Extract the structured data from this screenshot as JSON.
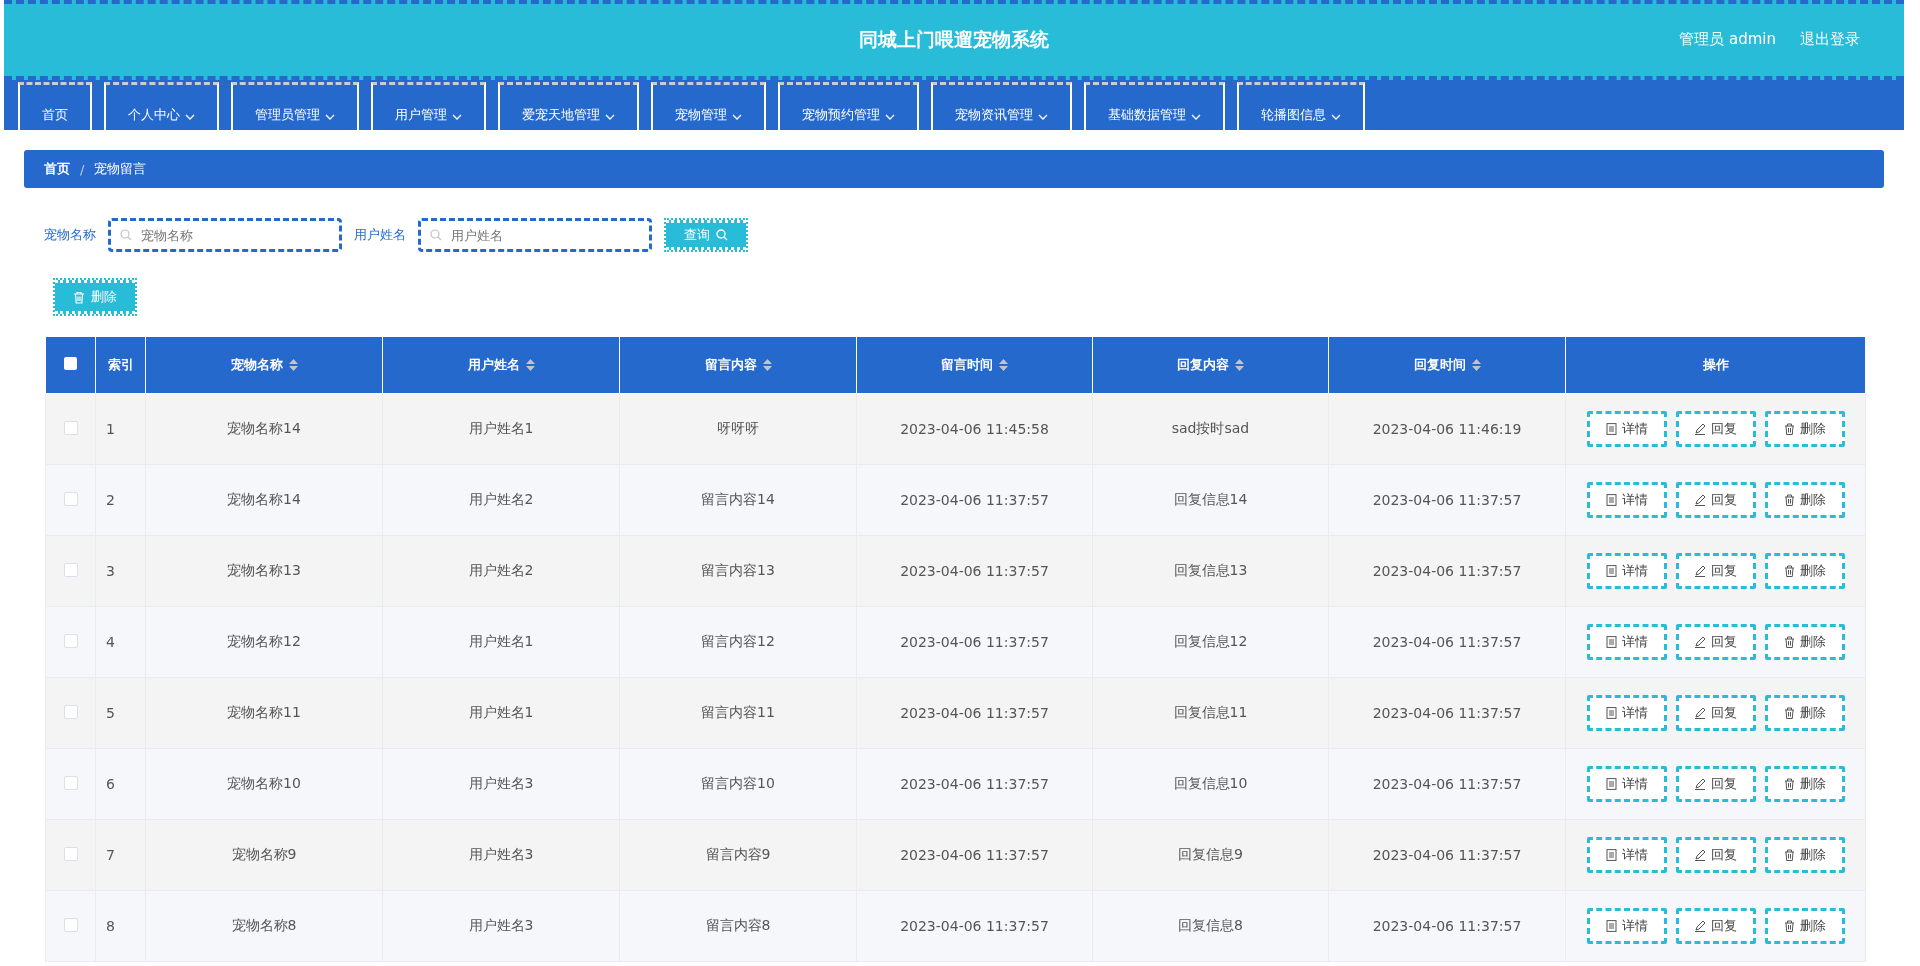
{
  "header": {
    "title": "同城上门喂遛宠物系统",
    "user": "管理员 admin",
    "logout": "退出登录"
  },
  "nav": [
    {
      "label": "首页",
      "dropdown": false
    },
    {
      "label": "个人中心",
      "dropdown": true
    },
    {
      "label": "管理员管理",
      "dropdown": true
    },
    {
      "label": "用户管理",
      "dropdown": true
    },
    {
      "label": "爱宠天地管理",
      "dropdown": true
    },
    {
      "label": "宠物管理",
      "dropdown": true
    },
    {
      "label": "宠物预约管理",
      "dropdown": true
    },
    {
      "label": "宠物资讯管理",
      "dropdown": true
    },
    {
      "label": "基础数据管理",
      "dropdown": true
    },
    {
      "label": "轮播图信息",
      "dropdown": true
    }
  ],
  "breadcrumb": {
    "items": [
      "首页",
      "宠物留言"
    ],
    "separator": "/"
  },
  "search": {
    "fields": [
      {
        "label": "宠物名称",
        "placeholder": "宠物名称"
      },
      {
        "label": "用户姓名",
        "placeholder": "用户姓名"
      }
    ],
    "button": "查询"
  },
  "delete_button": "删除",
  "table": {
    "select_all_checked": false,
    "columns": [
      {
        "label": "索引",
        "sortable": false
      },
      {
        "label": "宠物名称",
        "sortable": true
      },
      {
        "label": "用户姓名",
        "sortable": true
      },
      {
        "label": "留言内容",
        "sortable": true
      },
      {
        "label": "留言时间",
        "sortable": true
      },
      {
        "label": "回复内容",
        "sortable": true
      },
      {
        "label": "回复时间",
        "sortable": true
      },
      {
        "label": "操作",
        "sortable": false
      }
    ],
    "rows": [
      {
        "checked": false,
        "cells": [
          "1",
          "宠物名称14",
          "用户姓名1",
          "呀呀呀",
          "2023-04-06 11:45:58",
          "sad按时sad",
          "2023-04-06 11:46:19"
        ],
        "actions": [
          "详情",
          "回复",
          "删除"
        ]
      },
      {
        "checked": false,
        "cells": [
          "2",
          "宠物名称14",
          "用户姓名2",
          "留言内容14",
          "2023-04-06 11:37:57",
          "回复信息14",
          "2023-04-06 11:37:57"
        ],
        "actions": [
          "详情",
          "回复",
          "删除"
        ]
      },
      {
        "checked": false,
        "cells": [
          "3",
          "宠物名称13",
          "用户姓名2",
          "留言内容13",
          "2023-04-06 11:37:57",
          "回复信息13",
          "2023-04-06 11:37:57"
        ],
        "actions": [
          "详情",
          "回复",
          "删除"
        ]
      },
      {
        "checked": false,
        "cells": [
          "4",
          "宠物名称12",
          "用户姓名1",
          "留言内容12",
          "2023-04-06 11:37:57",
          "回复信息12",
          "2023-04-06 11:37:57"
        ],
        "actions": [
          "详情",
          "回复",
          "删除"
        ]
      },
      {
        "checked": false,
        "cells": [
          "5",
          "宠物名称11",
          "用户姓名1",
          "留言内容11",
          "2023-04-06 11:37:57",
          "回复信息11",
          "2023-04-06 11:37:57"
        ],
        "actions": [
          "详情",
          "回复",
          "删除"
        ]
      },
      {
        "checked": false,
        "cells": [
          "6",
          "宠物名称10",
          "用户姓名3",
          "留言内容10",
          "2023-04-06 11:37:57",
          "回复信息10",
          "2023-04-06 11:37:57"
        ],
        "actions": [
          "详情",
          "回复",
          "删除"
        ]
      },
      {
        "checked": false,
        "cells": [
          "7",
          "宠物名称9",
          "用户姓名3",
          "留言内容9",
          "2023-04-06 11:37:57",
          "回复信息9",
          "2023-04-06 11:37:57"
        ],
        "actions": [
          "详情",
          "回复",
          "删除"
        ]
      },
      {
        "checked": false,
        "cells": [
          "8",
          "宠物名称8",
          "用户姓名3",
          "留言内容8",
          "2023-04-06 11:37:57",
          "回复信息8",
          "2023-04-06 11:37:57"
        ],
        "actions": [
          "详情",
          "回复",
          "删除"
        ]
      }
    ]
  }
}
